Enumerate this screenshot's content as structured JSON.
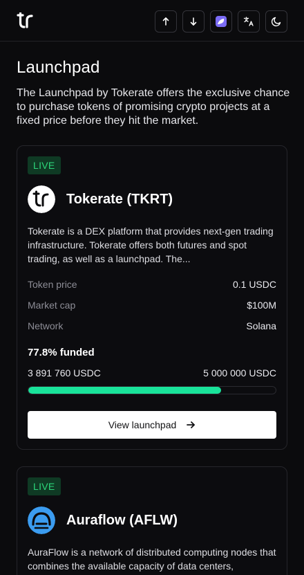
{
  "header": {
    "logo_icon": "tokerate-logo-icon",
    "buttons": [
      {
        "name": "arrow-up-icon"
      },
      {
        "name": "arrow-down-icon"
      },
      {
        "name": "wallet-app-icon",
        "accent": "#7b6cf6"
      },
      {
        "name": "translate-icon"
      },
      {
        "name": "moon-icon"
      }
    ]
  },
  "page": {
    "title": "Launchpad",
    "description": "The Launchpad by Tokerate offers the exclusive chance to purchase tokens of promising crypto projects at a fixed price before they hit the market."
  },
  "projects": [
    {
      "badge": "LIVE",
      "name": "Tokerate (TKRT)",
      "description": "Tokerate is a DEX platform that provides next-gen trading infrastructure. Tokerate offers both futures and spot trading, as well as a launchpad. The...",
      "stats": [
        {
          "label": "Token price",
          "value": "0.1 USDC"
        },
        {
          "label": "Market cap",
          "value": "$100M"
        },
        {
          "label": "Network",
          "value": "Solana"
        }
      ],
      "funded_text": "77.8% funded",
      "funded_fraction": 0.778,
      "raised": "3 891 760 USDC",
      "goal": "5 000 000 USDC",
      "button_label": "View launchpad"
    },
    {
      "badge": "LIVE",
      "name": "Auraflow (AFLW)",
      "description": "AuraFlow is a network of distributed computing nodes that combines the available capacity of data centers, enterprises, and mining farms into..."
    }
  ],
  "colors": {
    "background": "#0b0b0d",
    "live_badge_bg": "#0f3a24",
    "live_badge_text": "#2cd67a",
    "progress_fill": "#19e39a",
    "auraflow_logo": "#3b9cf0"
  }
}
